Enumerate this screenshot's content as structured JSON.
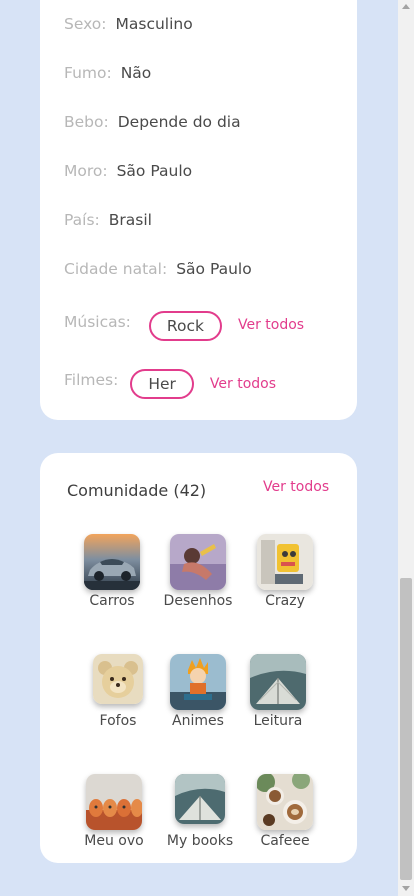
{
  "profile": {
    "details": [
      {
        "label": "Sexo:",
        "value": "Masculino"
      },
      {
        "label": "Fumo:",
        "value": "Não"
      },
      {
        "label": "Bebo:",
        "value": "Depende do dia"
      },
      {
        "label": "Moro:",
        "value": "São Paulo"
      },
      {
        "label": "País:",
        "value": "Brasil"
      },
      {
        "label": "Cidade natal:",
        "value": "São Paulo"
      }
    ],
    "music": {
      "label": "Músicas:",
      "tag": "Rock",
      "see_all": "Ver todos"
    },
    "movies": {
      "label": "Filmes:",
      "tag": "Her",
      "see_all": "Ver todos"
    }
  },
  "community": {
    "title": "Comunidade (42)",
    "see_all": "Ver todos",
    "items": [
      {
        "label": "Carros",
        "icon": "car-photo"
      },
      {
        "label": "Desenhos",
        "icon": "drawing-photo"
      },
      {
        "label": "Crazy",
        "icon": "toy-photo"
      },
      {
        "label": "Fofos",
        "icon": "teddy-bear-photo"
      },
      {
        "label": "Animes",
        "icon": "anime-figure-photo"
      },
      {
        "label": "Leitura",
        "icon": "book-photo"
      },
      {
        "label": "Meu ovo",
        "icon": "eggs-photo"
      },
      {
        "label": "My books",
        "icon": "open-book-photo"
      },
      {
        "label": "Cafeee",
        "icon": "coffee-photo"
      }
    ]
  },
  "colors": {
    "accent": "#e23c8c",
    "background": "#d7e3f6",
    "card": "#ffffff",
    "label": "#b7b7b7",
    "text": "#4a4a4a"
  }
}
